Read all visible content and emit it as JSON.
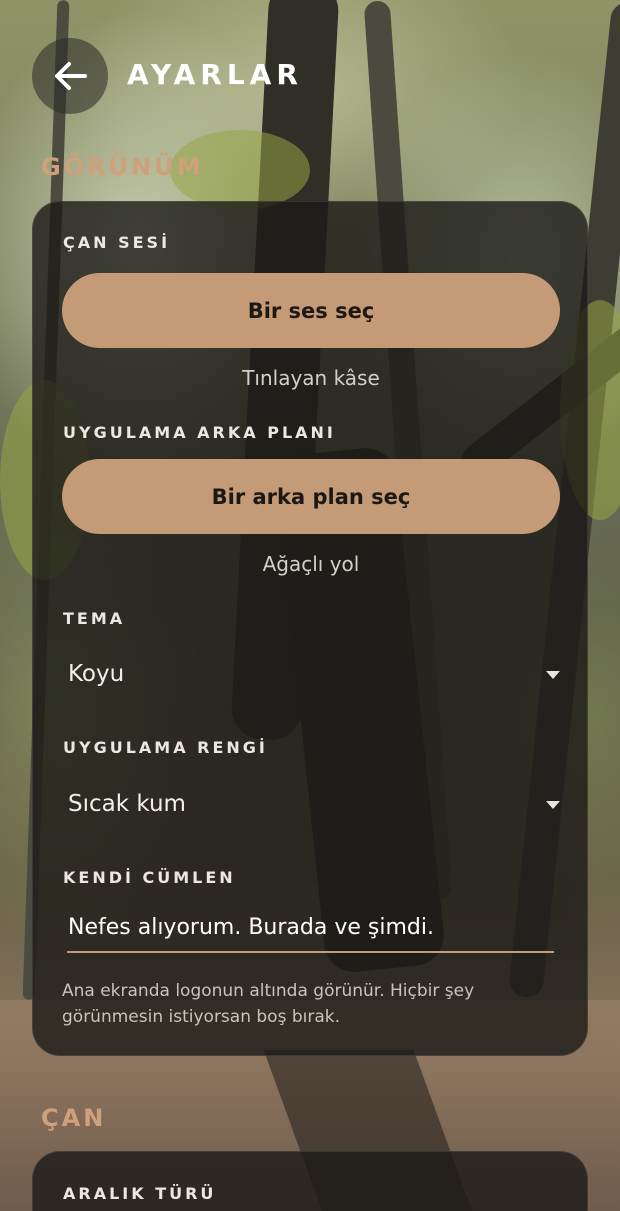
{
  "header": {
    "back_icon": "arrow-left-icon",
    "title": "AYARLAR"
  },
  "sections": {
    "appearance": {
      "title": "GÖRÜNÜM",
      "bell_sound": {
        "label": "ÇAN SESİ",
        "button": "Bir ses seç",
        "selected": "Tınlayan kâse"
      },
      "app_background": {
        "label": "UYGULAMA ARKA PLANI",
        "button": "Bir arka plan seç",
        "selected": "Ağaçlı yol"
      },
      "theme": {
        "label": "TEMA",
        "value": "Koyu"
      },
      "app_color": {
        "label": "UYGULAMA RENGİ",
        "value": "Sıcak kum"
      },
      "own_sentence": {
        "label": "KENDİ CÜMLEN",
        "value": "Nefes alıyorum. Burada ve şimdi.",
        "helper": "Ana ekranda logonun altında görünür. Hiçbir şey görünmesin istiyorsan boş bırak."
      }
    },
    "bell": {
      "title": "ÇAN",
      "interval_type": {
        "label": "ARALIK TÜRÜ"
      }
    }
  },
  "colors": {
    "accent": "#c49b76",
    "section_title": "#cfa07c",
    "card_bg": "#1c1a18"
  }
}
